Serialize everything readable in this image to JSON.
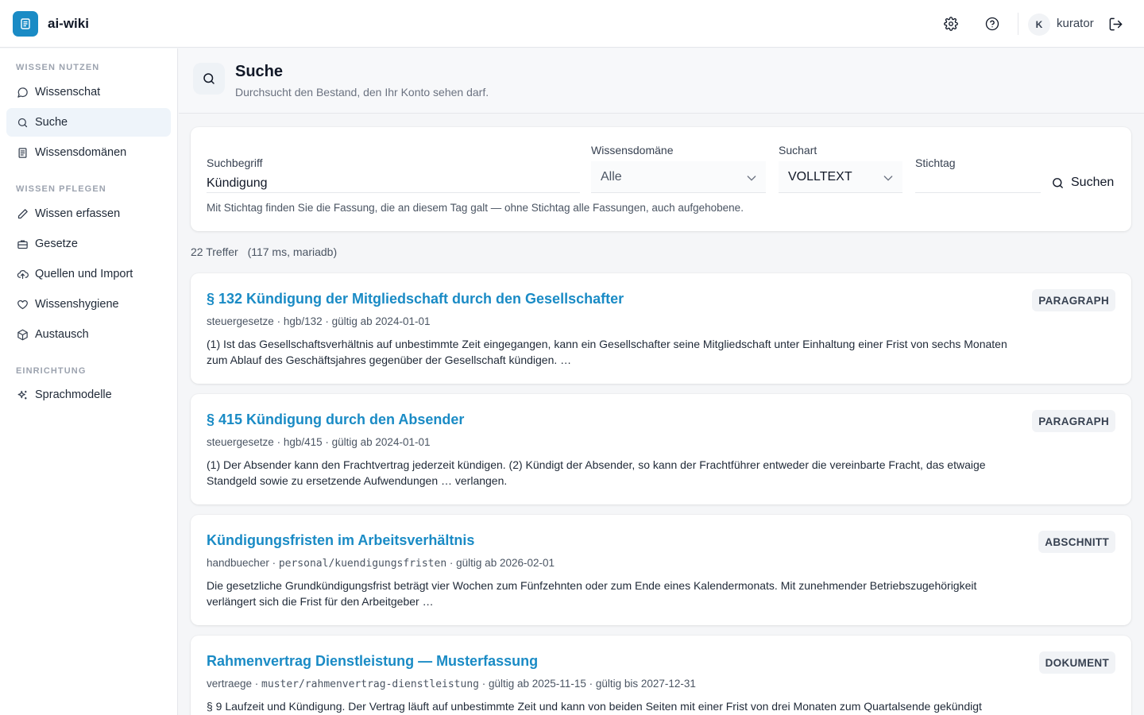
{
  "app": {
    "title": "ai-wiki"
  },
  "user": {
    "initial": "K",
    "name": "kurator"
  },
  "colors": {
    "accent": "#1a8bc5",
    "active_bg": "#eef4fa"
  },
  "sidebar": {
    "sections": [
      {
        "label": "WISSEN NUTZEN",
        "items": [
          {
            "label": "Wissenschat",
            "icon": "chat-icon"
          },
          {
            "label": "Suche",
            "icon": "search-icon",
            "active": true
          },
          {
            "label": "Wissensdomänen",
            "icon": "book-icon"
          }
        ]
      },
      {
        "label": "WISSEN PFLEGEN",
        "items": [
          {
            "label": "Wissen erfassen",
            "icon": "pencil-icon"
          },
          {
            "label": "Gesetze",
            "icon": "briefcase-icon"
          },
          {
            "label": "Quellen und Import",
            "icon": "cloud-upload-icon"
          },
          {
            "label": "Wissenshygiene",
            "icon": "heart-icon"
          },
          {
            "label": "Austausch",
            "icon": "package-icon"
          }
        ]
      },
      {
        "label": "EINRICHTUNG",
        "items": [
          {
            "label": "Sprachmodelle",
            "icon": "sparkles-icon"
          }
        ]
      }
    ]
  },
  "header": {
    "title": "Suche",
    "subtitle": "Durchsucht den Bestand, den Ihr Konto sehen darf."
  },
  "search": {
    "query_label": "Suchbegriff",
    "query_value": "Kündigung",
    "domain_label": "Wissensdomäne",
    "domain_value": "Alle",
    "mode_label": "Suchart",
    "mode_value": "VOLLTEXT",
    "date_label": "Stichtag",
    "date_value": "",
    "button_label": "Suchen",
    "hint": "Mit Stichtag finden Sie die Fassung, die an diesem Tag galt — ohne Stichtag alle Fassungen, auch aufgehobene."
  },
  "results_summary": {
    "count": "22 Treffer",
    "meta": "(117 ms, mariadb)"
  },
  "results": [
    {
      "title": "§ 132 Kündigung der Mitgliedschaft durch den Gesellschafter",
      "domain": "steuergesetze",
      "path": "hgb/132",
      "validity": "gültig ab 2024-01-01",
      "snippet": "(1) Ist das Gesellschaftsverhältnis auf unbestimmte Zeit eingegangen, kann ein Gesellschafter seine Mitgliedschaft unter Einhaltung einer Frist von sechs Monaten zum Ablauf des Geschäftsjahres gegenüber der Gesellschaft kündigen. …",
      "type": "PARAGRAPH"
    },
    {
      "title": "§ 415 Kündigung durch den Absender",
      "domain": "steuergesetze",
      "path": "hgb/415",
      "validity": "gültig ab 2024-01-01",
      "snippet": "(1) Der Absender kann den Frachtvertrag jederzeit kündigen. (2) Kündigt der Absender, so kann der Frachtführer entweder die vereinbarte Fracht, das etwaige Standgeld sowie zu ersetzende Aufwendungen … verlangen.",
      "type": "PARAGRAPH"
    },
    {
      "title": "Kündigungsfristen im Arbeitsverhältnis",
      "domain": "handbuecher",
      "path": "personal/kuendigungsfristen",
      "validity": "gültig ab 2026-02-01",
      "snippet": "Die gesetzliche Grundkündigungsfrist beträgt vier Wochen zum Fünfzehnten oder zum Ende eines Kalendermonats. Mit zunehmender Betriebszugehörigkeit verlängert sich die Frist für den Arbeitgeber …",
      "type": "ABSCHNITT"
    },
    {
      "title": "Rahmenvertrag Dienstleistung — Musterfassung",
      "domain": "vertraege",
      "path": "muster/rahmenvertrag-dienstleistung",
      "validity": "gültig ab 2025-11-15 · gültig bis 2027-12-31",
      "snippet": "§ 9 Laufzeit und Kündigung. Der Vertrag läuft auf unbestimmte Zeit und kann von beiden Seiten mit einer Frist von drei Monaten zum Quartalsende gekündigt",
      "type": "DOKUMENT"
    }
  ]
}
